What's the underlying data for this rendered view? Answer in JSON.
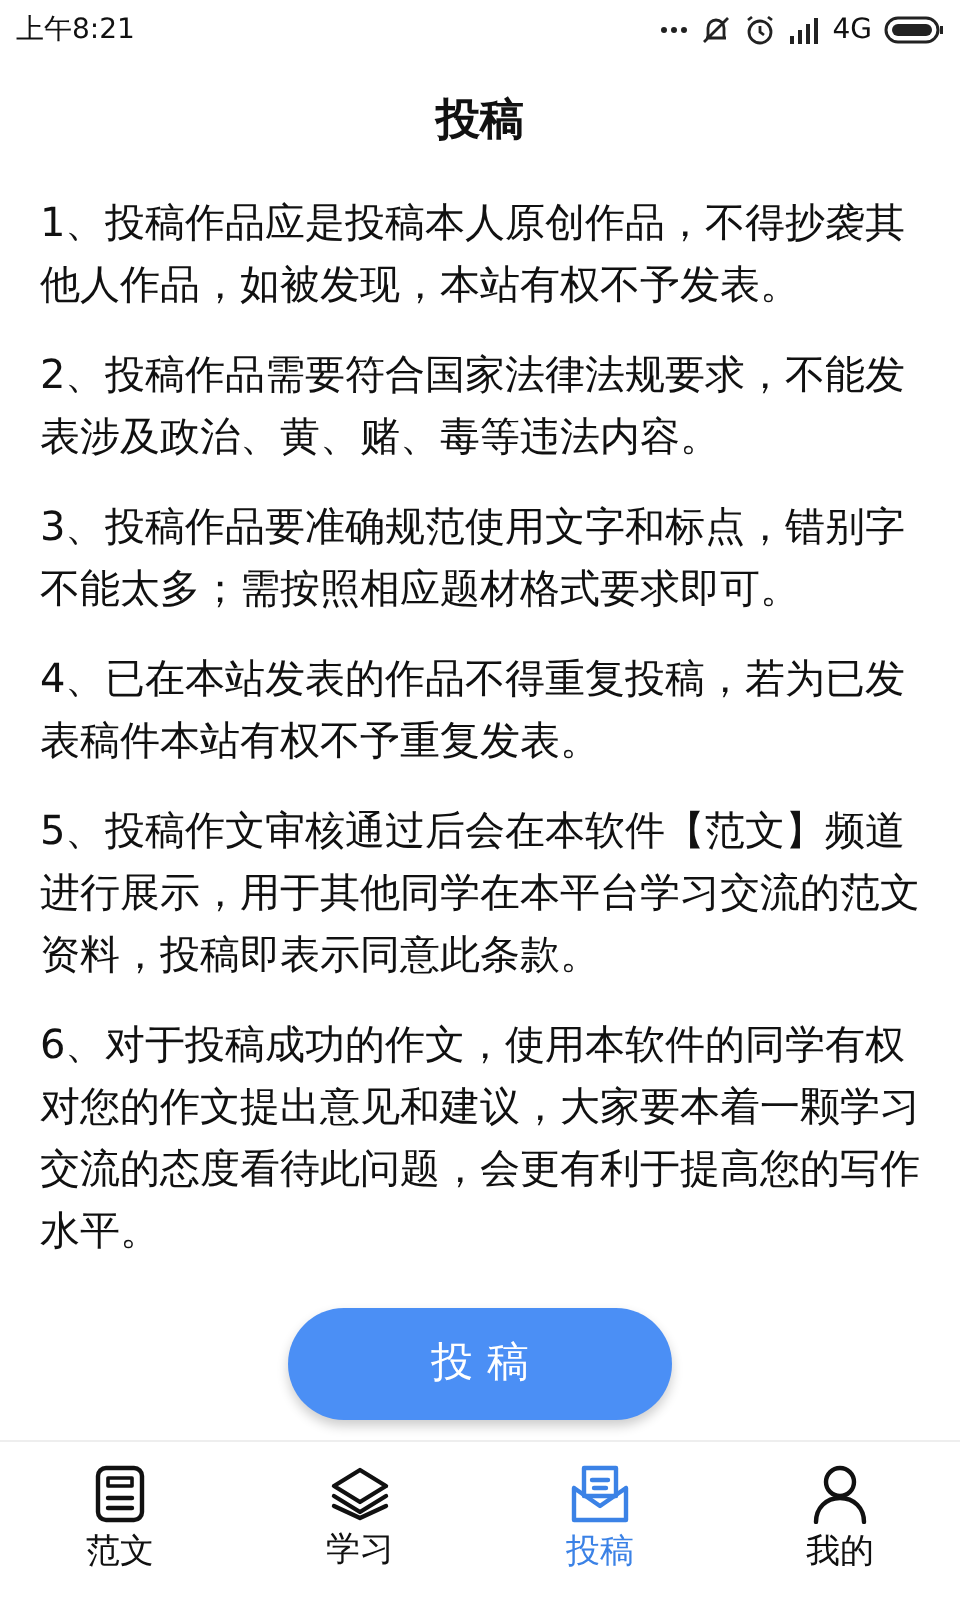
{
  "status_bar": {
    "time": "上午8:21",
    "network": "4G"
  },
  "title": "投稿",
  "rules": [
    "1、投稿作品应是投稿本人原创作品，不得抄袭其他人作品，如被发现，本站有权不予发表。",
    "2、投稿作品需要符合国家法律法规要求，不能发表涉及政治、黄、赌、毒等违法内容。",
    "3、投稿作品要准确规范使用文字和标点，错别字不能太多；需按照相应题材格式要求即可。",
    "4、已在本站发表的作品不得重复投稿，若为已发表稿件本站有权不予重复发表。",
    "5、投稿作文审核通过后会在本软件【范文】频道进行展示，用于其他同学在本平台学习交流的范文资料，投稿即表示同意此条款。",
    "6、对于投稿成功的作文，使用本软件的同学有权对您的作文提出意见和建议，大家要本着一颗学习交流的态度看待此问题，会更有利于提高您的写作水平。"
  ],
  "submit_button": "投 稿",
  "tabs": [
    {
      "label": "范文",
      "kind": "doc",
      "selected": false
    },
    {
      "label": "学习",
      "kind": "layers",
      "selected": false
    },
    {
      "label": "投稿",
      "kind": "mail",
      "selected": true
    },
    {
      "label": "我的",
      "kind": "user",
      "selected": false
    }
  ]
}
